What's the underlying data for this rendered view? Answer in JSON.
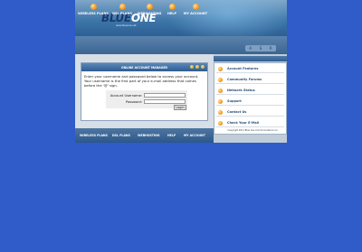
{
  "header": {
    "logo_main": "BLUE",
    "logo_accent": "ONE",
    "tagline": "www.blueone.net"
  },
  "nav": {
    "items": [
      {
        "label": "WIRELESS PLANS"
      },
      {
        "label": "DSL PLANS"
      },
      {
        "label": "WEBHOSTING"
      },
      {
        "label": "HELP"
      },
      {
        "label": "MY ACCOUNT"
      }
    ],
    "controls": [
      "A",
      "S",
      "R"
    ]
  },
  "login": {
    "title": "ONLINE ACCOUNT MANAGER",
    "instructions": "Enter your username and password below to access your account. Your username is the first part of your e-mail address that comes before the '@' sign.",
    "username_label": "Account Username:",
    "username_value": "",
    "password_label": "Password:",
    "password_value": "",
    "button": "Login"
  },
  "sidebar": {
    "items": [
      {
        "label": "Account Features"
      },
      {
        "label": "Community Forums"
      },
      {
        "label": "Network Status"
      },
      {
        "label": "Support"
      },
      {
        "label": "Contact Us"
      },
      {
        "label": "Check Your E-Mail"
      }
    ],
    "copyright": "Copyright 2011 Blue One Communications Inc."
  },
  "footer": {
    "items": [
      {
        "label": "WIRELESS PLANS"
      },
      {
        "label": "DSL PLANS"
      },
      {
        "label": "WEBHOSTING"
      },
      {
        "label": "HELP"
      },
      {
        "label": "MY ACCOUNT"
      }
    ]
  }
}
